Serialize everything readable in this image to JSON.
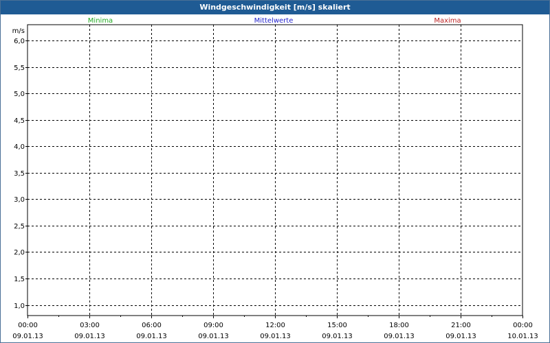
{
  "chart_data": {
    "type": "line",
    "title": "Windgeschwindigkeit [m/s] skaliert",
    "ylabel": "m/s",
    "ylim": [
      0.8,
      6.3
    ],
    "yticks": [
      1.0,
      1.5,
      2.0,
      2.5,
      3.0,
      3.5,
      4.0,
      4.5,
      5.0,
      5.5,
      6.0
    ],
    "ytick_labels": [
      "1,0",
      "1,5",
      "2,0",
      "2,5",
      "3,0",
      "3,5",
      "4,0",
      "4,5",
      "5,0",
      "5,5",
      "6,0"
    ],
    "xlim": [
      0,
      24
    ],
    "xticks": [
      0,
      3,
      6,
      9,
      12,
      15,
      18,
      21,
      24
    ],
    "xtick_time_labels": [
      "00:00",
      "03:00",
      "06:00",
      "09:00",
      "12:00",
      "15:00",
      "18:00",
      "21:00",
      "00:00"
    ],
    "xtick_date_labels": [
      "09.01.13",
      "09.01.13",
      "09.01.13",
      "09.01.13",
      "09.01.13",
      "09.01.13",
      "09.01.13",
      "09.01.13",
      "10.01.13"
    ],
    "grid": true,
    "legend_placement": "top",
    "series": [
      {
        "name": "Minima",
        "color": "#22aa22",
        "values": []
      },
      {
        "name": "Mittelwerte",
        "color": "#2222cc",
        "values": []
      },
      {
        "name": "Maxima",
        "color": "#bb2222",
        "values": []
      }
    ]
  }
}
